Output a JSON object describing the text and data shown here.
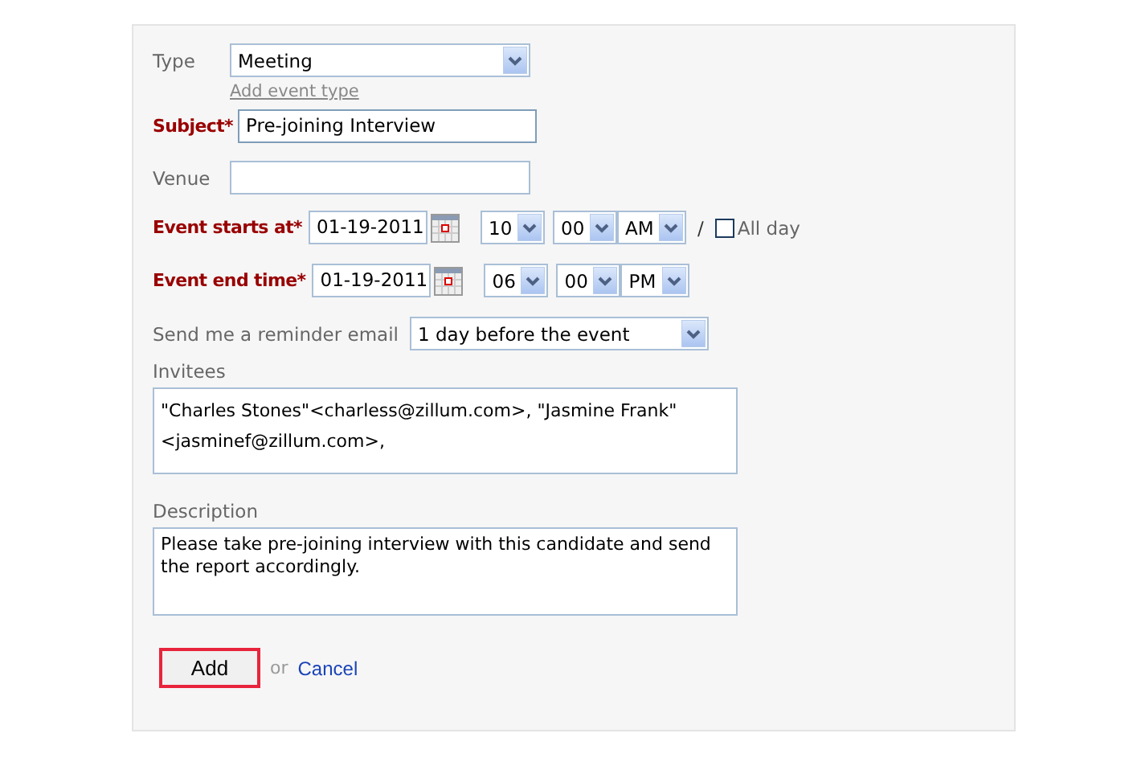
{
  "type": {
    "label": "Type",
    "value": "Meeting",
    "link": "Add event type"
  },
  "subject": {
    "label": "Subject*",
    "required": true,
    "value": "Pre-joining Interview"
  },
  "venue": {
    "label": "Venue",
    "required": false
  },
  "start": {
    "label": "Event starts at*",
    "required": true,
    "date": "01-19-2011",
    "hour": "10",
    "minute": "00",
    "meridiem": "AM",
    "separator": "/",
    "all_day": {
      "label": "All day",
      "checked": false
    }
  },
  "end": {
    "label": "Event end time*",
    "required": true,
    "date": "01-19-2011",
    "hour": "06",
    "minute": "00",
    "meridiem": "PM"
  },
  "reminder": {
    "label": "Send me a reminder email",
    "value": "1 day before the event"
  },
  "invitees": {
    "label": "Invitees",
    "value": "\"Charles Stones\"<charless@zillum.com>, \"Jasmine Frank\" <jasminef@zillum.com>,"
  },
  "description": {
    "label": "Description",
    "value": "Please take pre-joining interview with this candidate and send the report accordingly."
  },
  "actions": {
    "add": "Add",
    "or": "or",
    "cancel": "Cancel"
  }
}
